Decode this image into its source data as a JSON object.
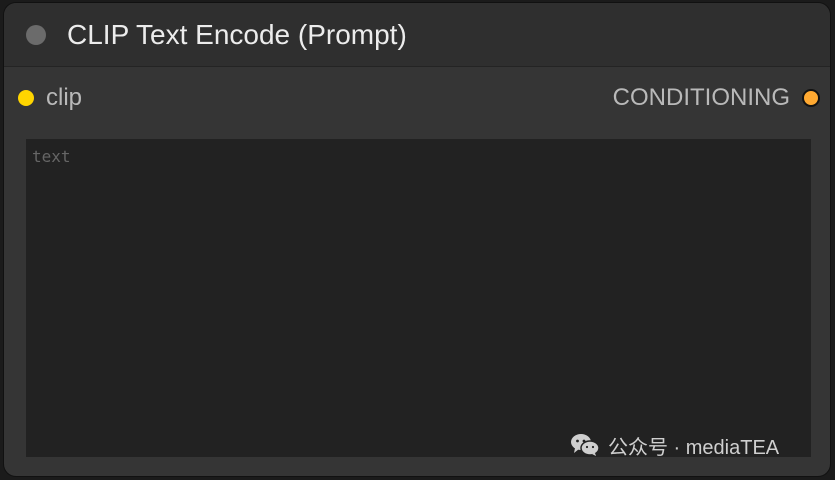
{
  "node": {
    "title": "CLIP Text Encode (Prompt)",
    "input": {
      "label": "clip",
      "color": "#ffd500"
    },
    "output": {
      "label": "CONDITIONING",
      "color": "#ffa931"
    },
    "text_widget": {
      "placeholder": "text",
      "value": ""
    }
  },
  "watermark": {
    "icon": "wechat-icon",
    "text": "公众号 · mediaTEA"
  },
  "colors": {
    "node_body": "#353535",
    "node_title": "#2f2f2f",
    "textarea_bg": "#222222"
  }
}
